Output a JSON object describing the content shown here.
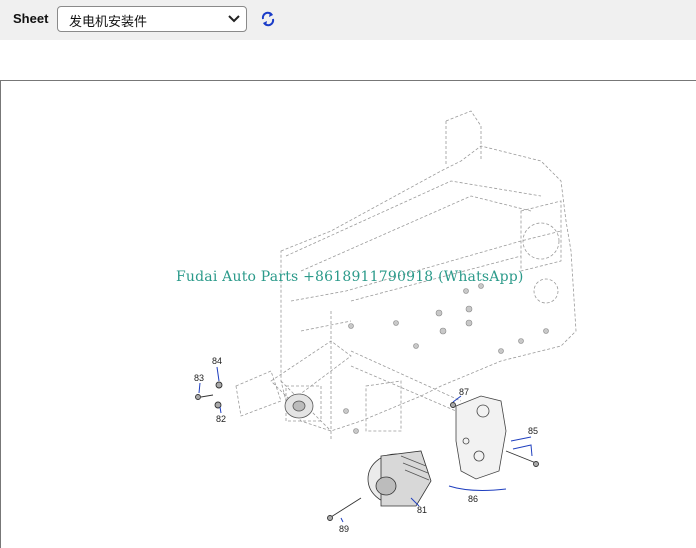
{
  "toolbar": {
    "sheet_label": "Sheet",
    "sheet_value": "发电机安装件",
    "refresh_icon": "refresh-icon"
  },
  "drawing": {
    "watermark": "Fudai Auto Parts +8618911790918 (WhatsApp)",
    "callouts": {
      "c81": "81",
      "c82": "82",
      "c83": "83",
      "c84": "84",
      "c85": "85",
      "c86": "86",
      "c87": "87",
      "c89": "89"
    },
    "leader_color": "#1f3fbf"
  }
}
